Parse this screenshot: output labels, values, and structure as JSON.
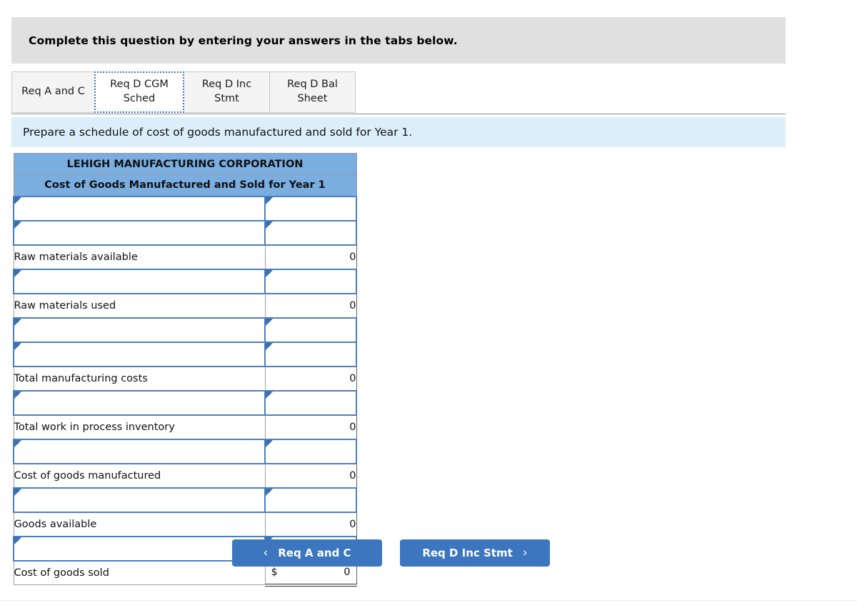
{
  "header": {
    "instruction": "Complete this question by entering your answers in the tabs below."
  },
  "tabs": [
    {
      "label": "Req A and C",
      "active": false
    },
    {
      "label": "Req D CGM Sched",
      "active": true
    },
    {
      "label": "Req D Inc Stmt",
      "active": false
    },
    {
      "label": "Req D Bal Sheet",
      "active": false
    }
  ],
  "requirement": {
    "text": "Prepare a schedule of cost of goods manufactured and sold for Year 1."
  },
  "sheet": {
    "company": "LEHIGH MANUFACTURING CORPORATION",
    "statement": "Cost of Goods Manufactured and Sold for Year 1",
    "rows": [
      {
        "type": "input",
        "label": "",
        "value": ""
      },
      {
        "type": "input",
        "label": "",
        "value": ""
      },
      {
        "type": "computed",
        "label": "Raw materials available",
        "value": "0",
        "currency": "",
        "final": false
      },
      {
        "type": "input",
        "label": "",
        "value": ""
      },
      {
        "type": "computed",
        "label": "Raw materials used",
        "value": "0",
        "currency": "",
        "final": false
      },
      {
        "type": "input",
        "label": "",
        "value": ""
      },
      {
        "type": "input",
        "label": "",
        "value": ""
      },
      {
        "type": "computed",
        "label": "Total manufacturing costs",
        "value": "0",
        "currency": "",
        "final": false
      },
      {
        "type": "input",
        "label": "",
        "value": ""
      },
      {
        "type": "computed",
        "label": "Total work in process inventory",
        "value": "0",
        "currency": "",
        "final": false
      },
      {
        "type": "input",
        "label": "",
        "value": ""
      },
      {
        "type": "computed",
        "label": "Cost of goods manufactured",
        "value": "0",
        "currency": "",
        "final": false
      },
      {
        "type": "input",
        "label": "",
        "value": ""
      },
      {
        "type": "computed",
        "label": "Goods available",
        "value": "0",
        "currency": "",
        "final": false
      },
      {
        "type": "input",
        "label": "",
        "value": ""
      },
      {
        "type": "computed",
        "label": "Cost of goods sold",
        "value": "0",
        "currency": "$",
        "final": true
      }
    ]
  },
  "nav": {
    "prev_label": "Req A and C",
    "prev_chevron": "‹",
    "next_label": "Req D Inc Stmt",
    "next_chevron": "›"
  },
  "colors": {
    "header_gray": "#e0e0e0",
    "req_bar_blue": "#ddeefb",
    "sheet_header_blue": "#7aaee0",
    "button_blue": "#3b76be",
    "input_border_blue": "#4a7fc1"
  }
}
